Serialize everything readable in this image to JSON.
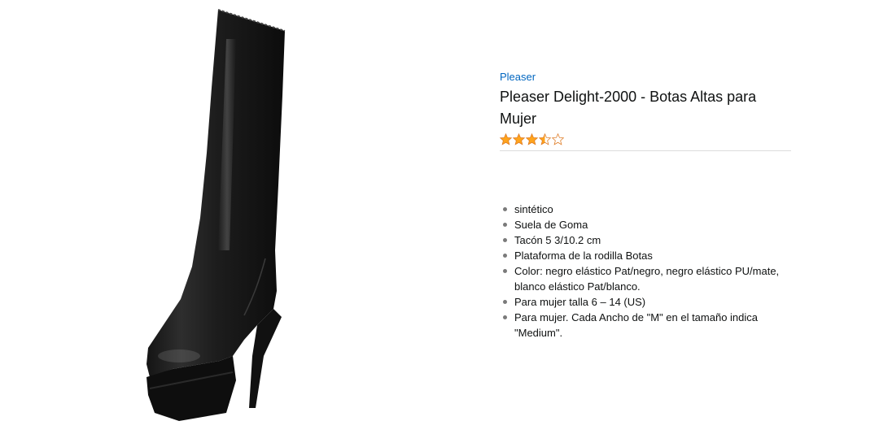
{
  "product": {
    "brand": "Pleaser",
    "title": "Pleaser Delight-2000 - Botas Altas para Mujer",
    "rating": 3.5,
    "rating_max": 5,
    "image_icon": "knee-high-boot-image",
    "bullets": [
      "sintético",
      "Suela de Goma",
      "Tacón 5 3/10.2 cm",
      "Plataforma de la rodilla Botas",
      "Color: negro elástico Pat/negro, negro elástico PU/mate, blanco elástico Pat/blanco.",
      "Para mujer talla 6 – 14 (US)",
      "Para mujer. Cada Ancho de \"M\" en el tamaño indica \"Medium\"."
    ]
  },
  "colors": {
    "brand_link": "#0066c0",
    "star_fill": "#ffa41c",
    "star_stroke": "#de7921",
    "text": "#0f1111"
  }
}
